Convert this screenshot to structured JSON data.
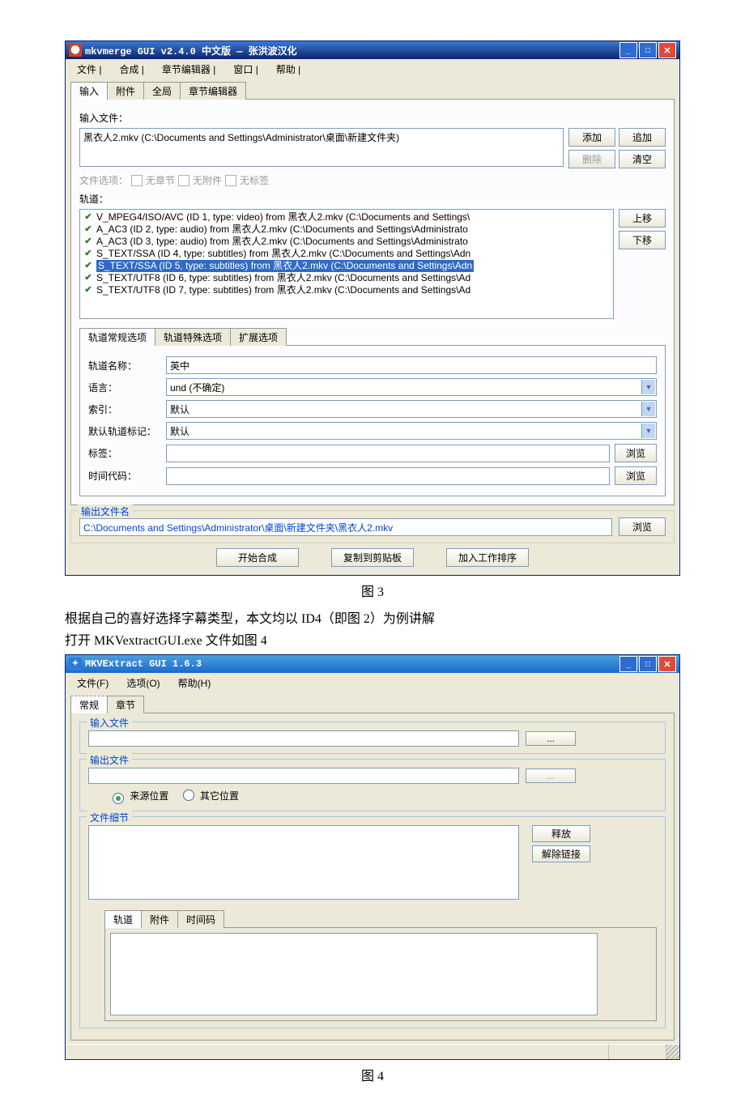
{
  "win1": {
    "title": "mkvmerge GUI v2.4.0 中文版 — 张洪波汉化",
    "menubar": [
      "文件 |",
      "合成 |",
      "章节编辑器 |",
      "窗口 |",
      "帮助 |"
    ],
    "tabs": [
      "输入",
      "附件",
      "全局",
      "章节编辑器"
    ],
    "input_label": "输入文件：",
    "file_item": "黑衣人2.mkv (C:\\Documents and Settings\\Administrator\\桌面\\新建文件夹)",
    "btn_add": "添加",
    "btn_append": "追加",
    "btn_remove": "删除",
    "btn_clear": "清空",
    "fileopts_label": "文件选项：",
    "chk1": "无章节",
    "chk2": "无附件",
    "chk3": "无标签",
    "tracks_label": "轨道：",
    "tracks": [
      "V_MPEG4/ISO/AVC (ID 1, type: video) from 黑衣人2.mkv (C:\\Documents and Settings\\",
      "A_AC3 (ID 2, type: audio) from 黑衣人2.mkv (C:\\Documents and Settings\\Administrato",
      "A_AC3 (ID 3, type: audio) from 黑衣人2.mkv (C:\\Documents and Settings\\Administrato",
      "S_TEXT/SSA (ID 4, type: subtitles) from 黑衣人2.mkv (C:\\Documents and Settings\\Adn",
      "S_TEXT/SSA (ID 5, type: subtitles) from 黑衣人2.mkv (C:\\Documents and Settings\\Adn",
      "S_TEXT/UTF8 (ID 6, type: subtitles) from 黑衣人2.mkv (C:\\Documents and Settings\\Ad",
      "S_TEXT/UTF8 (ID 7, type: subtitles) from 黑衣人2.mkv (C:\\Documents and Settings\\Ad"
    ],
    "btn_up": "上移",
    "btn_down": "下移",
    "subtabs": [
      "轨道常规选项",
      "轨道特殊选项",
      "扩展选项"
    ],
    "f_name_lbl": "轨道名称：",
    "f_name_val": "英中",
    "f_lang_lbl": "语言：",
    "f_lang_val": "und (不确定)",
    "f_idx_lbl": "索引：",
    "f_idx_val": "默认",
    "f_def_lbl": "默认轨道标记：",
    "f_def_val": "默认",
    "f_tags_lbl": "标签：",
    "f_tags_val": "",
    "f_tc_lbl": "时间代码：",
    "f_tc_val": "",
    "btn_browse": "浏览",
    "out_group": "输出文件名",
    "out_path": "C:\\Documents and Settings\\Administrator\\桌面\\新建文件夹\\黑衣人2.mkv",
    "btn_start": "开始合成",
    "btn_copy": "复制到剪贴板",
    "btn_queue": "加入工作排序"
  },
  "fig3": "图 3",
  "body1": "根据自己的喜好选择字幕类型，本文均以 ID4（即图 2）为例讲解",
  "body2": "打开 MKVextractGUI.exe 文件如图 4",
  "win2": {
    "title": "MKVExtract GUI 1.6.3",
    "menubar": [
      "文件(F)",
      "选项(O)",
      "帮助(H)"
    ],
    "tabs": [
      "常规",
      "章节"
    ],
    "g_input": "输入文件",
    "g_output": "输出文件",
    "radio_src": "来源位置",
    "radio_other": "其它位置",
    "g_detail": "文件细节",
    "btn_release": "释放",
    "btn_unlink": "解除链接",
    "subtabs": [
      "轨道",
      "附件",
      "时间码"
    ],
    "btn_dots": "..."
  },
  "fig4": "图 4"
}
